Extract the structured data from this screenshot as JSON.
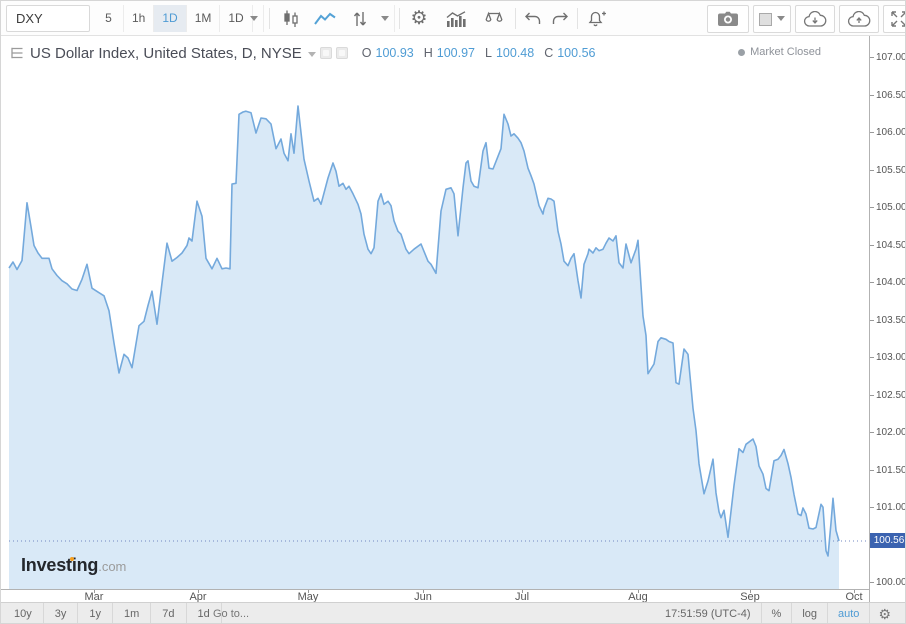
{
  "toolbar": {
    "symbol_value": "DXY",
    "intervals": [
      {
        "label": "5",
        "selected": false
      },
      {
        "label": "1h",
        "selected": false
      },
      {
        "label": "1D",
        "selected": true
      },
      {
        "label": "1M",
        "selected": false
      },
      {
        "label": "1D",
        "selected": false
      }
    ]
  },
  "header": {
    "title": "US Dollar Index, United States, D, NYSE",
    "ohlc": [
      {
        "label": "O",
        "value": "100.93"
      },
      {
        "label": "H",
        "value": "100.97"
      },
      {
        "label": "L",
        "value": "100.48"
      },
      {
        "label": "C",
        "value": "100.56"
      }
    ],
    "market_status": "Market Closed"
  },
  "chart_data": {
    "type": "area",
    "title": "US Dollar Index, United States, D, NYSE",
    "xlabel": "",
    "ylabel": "",
    "grid": false,
    "legend_position": "none",
    "ylim": [
      100.0,
      107.0
    ],
    "y_tick_labels": [
      "107.00",
      "106.50",
      "106.00",
      "105.50",
      "105.00",
      "104.50",
      "104.00",
      "103.50",
      "103.00",
      "102.50",
      "102.00",
      "101.50",
      "101.00",
      "100.50",
      "100.00"
    ],
    "x_ticks": [
      {
        "label": "Mar",
        "x": 93
      },
      {
        "label": "Apr",
        "x": 197
      },
      {
        "label": "May",
        "x": 307
      },
      {
        "label": "Jun",
        "x": 422
      },
      {
        "label": "Jul",
        "x": 521
      },
      {
        "label": "Aug",
        "x": 637
      },
      {
        "label": "Sep",
        "x": 749
      },
      {
        "label": "Oct",
        "x": 853
      }
    ],
    "last_price": "100.56",
    "last_price_value": 100.56,
    "colors": {
      "line": "#74a9dc",
      "fill": "#d9e9f7",
      "price_line": "#7187c0",
      "price_label_bg": "#3b63b0"
    },
    "series": [
      {
        "name": "US Dollar Index",
        "points": [
          [
            8,
            104.2
          ],
          [
            12,
            104.28
          ],
          [
            16,
            104.18
          ],
          [
            21,
            104.3
          ],
          [
            26,
            105.07
          ],
          [
            30,
            104.75
          ],
          [
            33,
            104.5
          ],
          [
            37,
            104.4
          ],
          [
            41,
            104.33
          ],
          [
            48,
            104.33
          ],
          [
            51,
            104.19
          ],
          [
            56,
            104.1
          ],
          [
            61,
            104.03
          ],
          [
            66,
            103.99
          ],
          [
            71,
            103.92
          ],
          [
            76,
            103.9
          ],
          [
            81,
            104.05
          ],
          [
            86,
            104.25
          ],
          [
            91,
            103.93
          ],
          [
            98,
            103.87
          ],
          [
            103,
            103.83
          ],
          [
            108,
            103.63
          ],
          [
            113,
            103.2
          ],
          [
            118,
            102.8
          ],
          [
            123,
            103.05
          ],
          [
            127,
            103.0
          ],
          [
            131,
            102.87
          ],
          [
            138,
            103.43
          ],
          [
            143,
            103.49
          ],
          [
            147,
            103.7
          ],
          [
            151,
            103.89
          ],
          [
            156,
            103.45
          ],
          [
            161,
            104.0
          ],
          [
            166,
            104.53
          ],
          [
            171,
            104.29
          ],
          [
            176,
            104.34
          ],
          [
            181,
            104.4
          ],
          [
            186,
            104.5
          ],
          [
            188,
            104.6
          ],
          [
            191,
            104.56
          ],
          [
            196,
            105.09
          ],
          [
            201,
            104.89
          ],
          [
            205,
            104.33
          ],
          [
            211,
            104.19
          ],
          [
            216,
            104.33
          ],
          [
            221,
            104.19
          ],
          [
            225,
            104.2
          ],
          [
            229,
            104.19
          ],
          [
            231,
            105.32
          ],
          [
            235,
            105.33
          ],
          [
            238,
            106.25
          ],
          [
            242,
            106.28
          ],
          [
            245,
            106.29
          ],
          [
            250,
            106.27
          ],
          [
            255,
            106.0
          ],
          [
            260,
            106.2
          ],
          [
            265,
            106.19
          ],
          [
            270,
            106.12
          ],
          [
            275,
            105.79
          ],
          [
            280,
            105.92
          ],
          [
            283,
            105.73
          ],
          [
            287,
            105.63
          ],
          [
            290,
            105.99
          ],
          [
            293,
            105.73
          ],
          [
            297,
            106.36
          ],
          [
            303,
            105.65
          ],
          [
            308,
            105.36
          ],
          [
            313,
            105.09
          ],
          [
            317,
            105.13
          ],
          [
            320,
            105.05
          ],
          [
            327,
            105.4
          ],
          [
            332,
            105.6
          ],
          [
            335,
            105.49
          ],
          [
            338,
            105.29
          ],
          [
            342,
            105.33
          ],
          [
            345,
            105.25
          ],
          [
            348,
            105.29
          ],
          [
            352,
            105.19
          ],
          [
            357,
            105.05
          ],
          [
            360,
            104.92
          ],
          [
            363,
            104.65
          ],
          [
            367,
            104.45
          ],
          [
            370,
            104.39
          ],
          [
            373,
            104.47
          ],
          [
            377,
            105.09
          ],
          [
            380,
            105.19
          ],
          [
            383,
            105.05
          ],
          [
            387,
            105.09
          ],
          [
            390,
            105.03
          ],
          [
            393,
            104.83
          ],
          [
            397,
            104.69
          ],
          [
            400,
            104.65
          ],
          [
            405,
            104.45
          ],
          [
            408,
            104.39
          ],
          [
            413,
            104.45
          ],
          [
            420,
            104.52
          ],
          [
            427,
            104.29
          ],
          [
            430,
            104.25
          ],
          [
            435,
            104.13
          ],
          [
            440,
            104.96
          ],
          [
            445,
            105.25
          ],
          [
            450,
            105.27
          ],
          [
            453,
            105.19
          ],
          [
            457,
            104.63
          ],
          [
            462,
            105.27
          ],
          [
            465,
            105.6
          ],
          [
            467,
            105.63
          ],
          [
            470,
            105.36
          ],
          [
            473,
            105.29
          ],
          [
            477,
            105.27
          ],
          [
            482,
            105.76
          ],
          [
            485,
            105.87
          ],
          [
            488,
            105.53
          ],
          [
            492,
            105.52
          ],
          [
            497,
            105.69
          ],
          [
            500,
            105.79
          ],
          [
            503,
            106.25
          ],
          [
            507,
            106.12
          ],
          [
            510,
            105.96
          ],
          [
            513,
            105.99
          ],
          [
            517,
            105.93
          ],
          [
            520,
            105.87
          ],
          [
            523,
            105.76
          ],
          [
            527,
            105.53
          ],
          [
            530,
            105.43
          ],
          [
            533,
            105.32
          ],
          [
            538,
            105.03
          ],
          [
            542,
            104.92
          ],
          [
            543,
            104.99
          ],
          [
            547,
            105.13
          ],
          [
            550,
            105.12
          ],
          [
            553,
            105.09
          ],
          [
            557,
            104.69
          ],
          [
            560,
            104.52
          ],
          [
            563,
            104.29
          ],
          [
            567,
            104.23
          ],
          [
            570,
            104.33
          ],
          [
            573,
            104.39
          ],
          [
            577,
            104.03
          ],
          [
            580,
            103.8
          ],
          [
            583,
            104.25
          ],
          [
            587,
            104.39
          ],
          [
            588,
            104.45
          ],
          [
            592,
            104.4
          ],
          [
            595,
            104.47
          ],
          [
            598,
            104.43
          ],
          [
            602,
            104.45
          ],
          [
            605,
            104.53
          ],
          [
            608,
            104.6
          ],
          [
            612,
            104.56
          ],
          [
            615,
            104.63
          ],
          [
            618,
            104.27
          ],
          [
            622,
            104.2
          ],
          [
            625,
            104.52
          ],
          [
            630,
            104.27
          ],
          [
            635,
            104.45
          ],
          [
            637,
            104.57
          ],
          [
            642,
            103.56
          ],
          [
            645,
            103.3
          ],
          [
            647,
            102.79
          ],
          [
            653,
            102.92
          ],
          [
            657,
            103.22
          ],
          [
            660,
            103.27
          ],
          [
            665,
            103.25
          ],
          [
            668,
            103.22
          ],
          [
            672,
            103.2
          ],
          [
            675,
            102.67
          ],
          [
            678,
            102.65
          ],
          [
            683,
            103.12
          ],
          [
            687,
            103.05
          ],
          [
            692,
            102.33
          ],
          [
            695,
            102.03
          ],
          [
            698,
            101.59
          ],
          [
            703,
            101.19
          ],
          [
            707,
            101.36
          ],
          [
            712,
            101.65
          ],
          [
            715,
            101.2
          ],
          [
            718,
            100.95
          ],
          [
            720,
            100.87
          ],
          [
            723,
            100.97
          ],
          [
            727,
            100.61
          ],
          [
            733,
            101.3
          ],
          [
            738,
            101.79
          ],
          [
            742,
            101.74
          ],
          [
            745,
            101.85
          ],
          [
            752,
            101.92
          ],
          [
            755,
            101.82
          ],
          [
            758,
            101.56
          ],
          [
            762,
            101.45
          ],
          [
            765,
            101.26
          ],
          [
            768,
            101.23
          ],
          [
            773,
            101.63
          ],
          [
            777,
            101.65
          ],
          [
            780,
            101.7
          ],
          [
            783,
            101.78
          ],
          [
            787,
            101.59
          ],
          [
            790,
            101.41
          ],
          [
            793,
            101.18
          ],
          [
            797,
            100.92
          ],
          [
            800,
            100.9
          ],
          [
            802,
            101.0
          ],
          [
            805,
            100.92
          ],
          [
            808,
            100.73
          ],
          [
            812,
            100.72
          ],
          [
            815,
            100.74
          ],
          [
            820,
            101.05
          ],
          [
            822,
            101.01
          ],
          [
            825,
            100.43
          ],
          [
            827,
            100.36
          ],
          [
            830,
            100.8
          ],
          [
            832,
            101.13
          ],
          [
            835,
            100.7
          ],
          [
            838,
            100.56
          ]
        ]
      }
    ]
  },
  "bottom_bar": {
    "ranges": [
      "10y",
      "3y",
      "1y",
      "1m",
      "7d",
      "1d"
    ],
    "goto_label": "Go to...",
    "clock": "17:51:59 (UTC-4)",
    "items": [
      {
        "label": "%",
        "active": false
      },
      {
        "label": "log",
        "active": false
      },
      {
        "label": "auto",
        "active": true
      }
    ]
  },
  "watermark": {
    "brand": "Investing",
    "suffix": ".com"
  }
}
